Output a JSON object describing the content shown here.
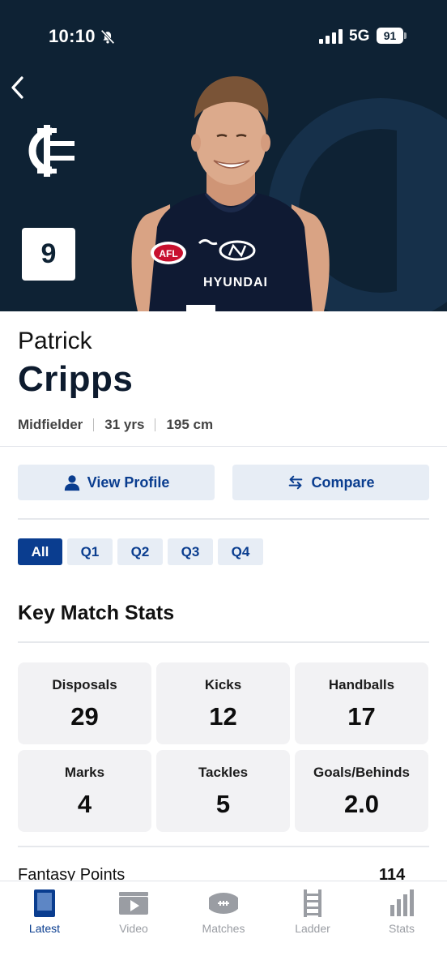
{
  "status_bar": {
    "time": "10:10",
    "network": "5G",
    "battery": "91"
  },
  "player": {
    "first_name": "Patrick",
    "last_name": "Cripps",
    "jersey_number": "9",
    "position": "Midfielder",
    "age": "31 yrs",
    "height": "195 cm",
    "sponsor": "HYUNDAI"
  },
  "actions": {
    "view_profile": "View Profile",
    "compare": "Compare"
  },
  "quarter_tabs": [
    {
      "label": "All",
      "active": true
    },
    {
      "label": "Q1",
      "active": false
    },
    {
      "label": "Q2",
      "active": false
    },
    {
      "label": "Q3",
      "active": false
    },
    {
      "label": "Q4",
      "active": false
    }
  ],
  "key_stats": {
    "title": "Key Match Stats",
    "items": [
      {
        "label": "Disposals",
        "value": "29"
      },
      {
        "label": "Kicks",
        "value": "12"
      },
      {
        "label": "Handballs",
        "value": "17"
      },
      {
        "label": "Marks",
        "value": "4"
      },
      {
        "label": "Tackles",
        "value": "5"
      },
      {
        "label": "Goals/Behinds",
        "value": "2.0"
      }
    ]
  },
  "fantasy": {
    "label": "Fantasy Points",
    "value": "114"
  },
  "tab_bar": [
    {
      "label": "Latest",
      "icon": "latest-icon",
      "active": true
    },
    {
      "label": "Video",
      "icon": "video-icon",
      "active": false
    },
    {
      "label": "Matches",
      "icon": "football-icon",
      "active": false
    },
    {
      "label": "Ladder",
      "icon": "ladder-icon",
      "active": false
    },
    {
      "label": "Stats",
      "icon": "stats-icon",
      "active": false
    }
  ],
  "colors": {
    "hero_bg": "#0e2234",
    "accent": "#0a3d8f",
    "button_bg": "#e7edf5",
    "card_bg": "#f2f2f4"
  }
}
